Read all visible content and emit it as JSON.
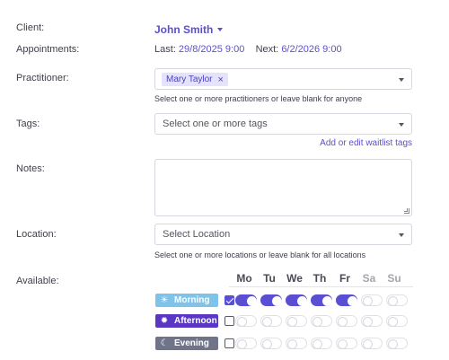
{
  "labels": {
    "client": "Client:",
    "appointments": "Appointments:",
    "practitioner": "Practitioner:",
    "tags": "Tags:",
    "notes": "Notes:",
    "location": "Location:",
    "available": "Available:"
  },
  "client": {
    "name": "John Smith"
  },
  "appointments": {
    "last_label": "Last:",
    "last_value": "29/8/2025 9:00",
    "next_label": "Next:",
    "next_value": "6/2/2026 9:00"
  },
  "practitioner": {
    "chip": "Mary Taylor",
    "hint": "Select one or more practitioners or leave blank for anyone"
  },
  "tags": {
    "placeholder": "Select one or more tags",
    "link": "Add or edit waitlist tags"
  },
  "notes": {
    "value": ""
  },
  "location": {
    "placeholder": "Select Location",
    "hint": "Select one or more locations or leave blank for all locations"
  },
  "availability": {
    "days": [
      "Mo",
      "Tu",
      "We",
      "Th",
      "Fr",
      "Sa",
      "Su"
    ],
    "periods": [
      {
        "label": "Morning",
        "icon": "sunrise-icon",
        "color": "#7ec3ea",
        "all": true,
        "days": [
          true,
          true,
          true,
          true,
          true,
          false,
          false
        ]
      },
      {
        "label": "Afternoon",
        "icon": "sun-icon",
        "color": "#5a36c5",
        "all": false,
        "days": [
          false,
          false,
          false,
          false,
          false,
          false,
          false
        ]
      },
      {
        "label": "Evening",
        "icon": "moon-icon",
        "color": "#6f7488",
        "all": false,
        "days": [
          false,
          false,
          false,
          false,
          false,
          false,
          false
        ]
      }
    ]
  },
  "colors": {
    "accent": "#5a4fd3"
  }
}
